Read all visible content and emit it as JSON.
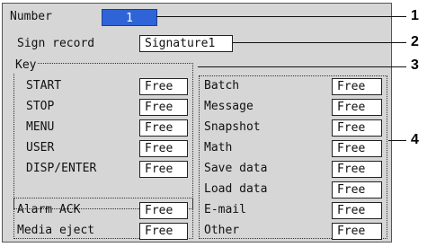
{
  "header": {
    "number_label": "Number",
    "number_value": "1",
    "sign_record_label": "Sign record",
    "sign_record_value": "Signature1"
  },
  "key_group": {
    "title": "Key",
    "rows": [
      {
        "label": "START",
        "value": "Free"
      },
      {
        "label": "STOP",
        "value": "Free"
      },
      {
        "label": "MENU",
        "value": "Free"
      },
      {
        "label": "USER",
        "value": "Free"
      },
      {
        "label": "DISP/ENTER",
        "value": "Free"
      }
    ]
  },
  "left_extra": [
    {
      "label": "Alarm ACK",
      "value": "Free"
    },
    {
      "label": "Media eject",
      "value": "Free"
    }
  ],
  "right_group": [
    {
      "label": "Batch",
      "value": "Free"
    },
    {
      "label": "Message",
      "value": "Free"
    },
    {
      "label": "Snapshot",
      "value": "Free"
    },
    {
      "label": "Math",
      "value": "Free"
    },
    {
      "label": "Save data",
      "value": "Free"
    },
    {
      "label": "Load data",
      "value": "Free"
    },
    {
      "label": "E-mail",
      "value": "Free"
    },
    {
      "label": "Other",
      "value": "Free"
    }
  ],
  "callouts": [
    "1",
    "2",
    "3",
    "4"
  ]
}
